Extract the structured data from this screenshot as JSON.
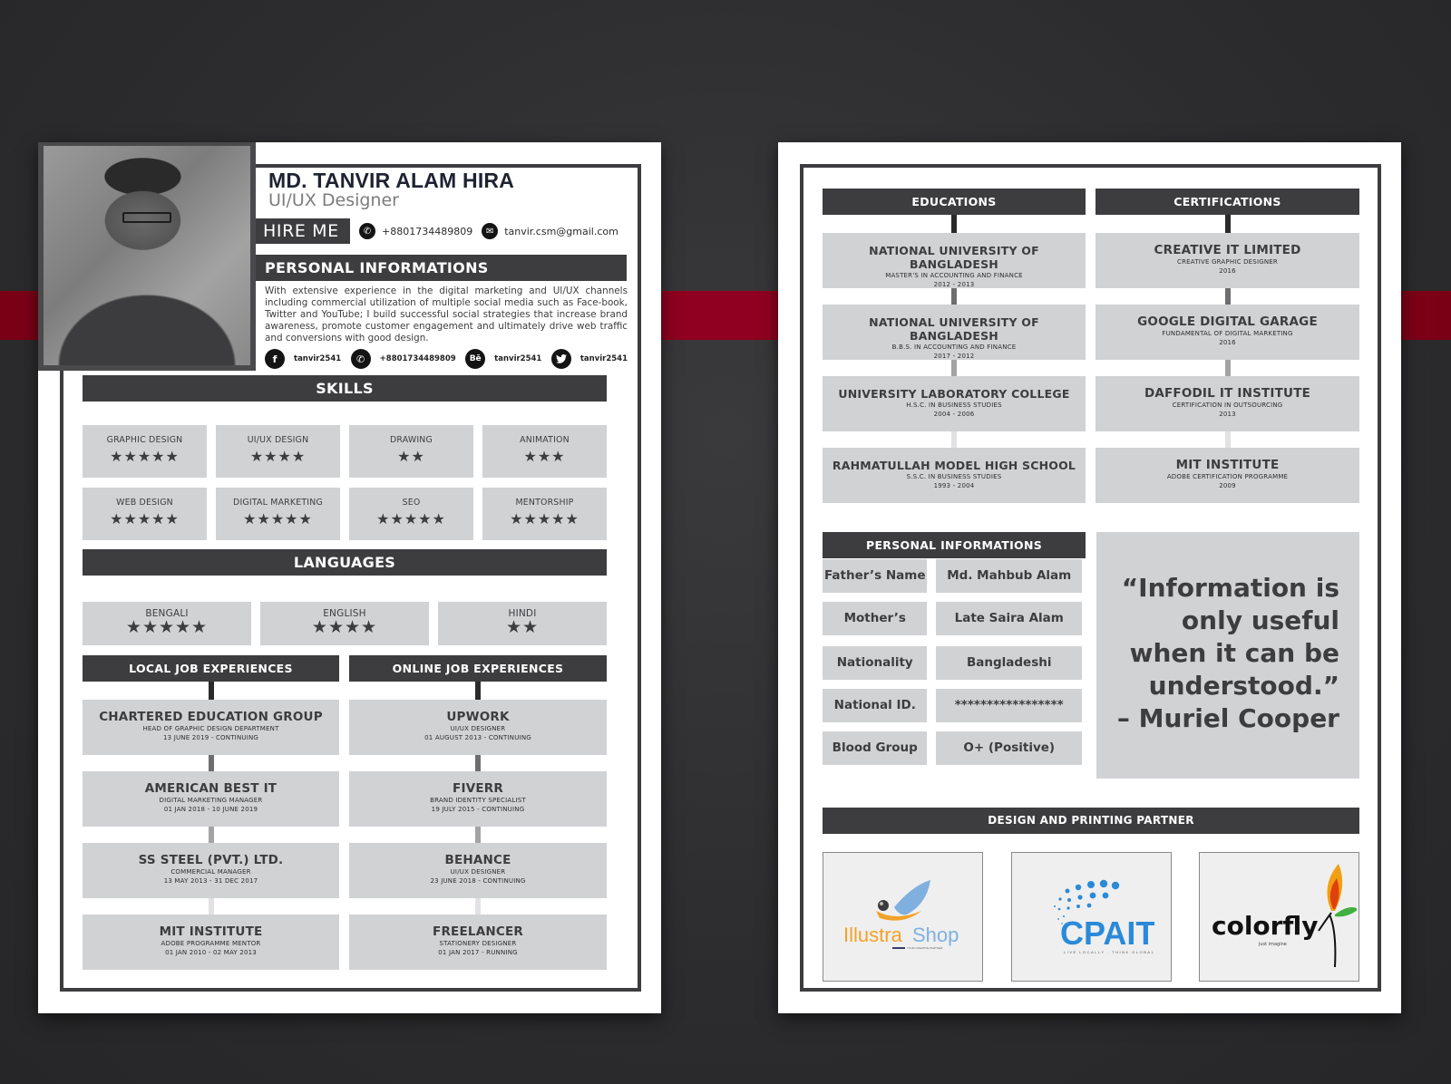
{
  "resume": {
    "name": "MD. TANVIR ALAM HIRA",
    "title": "UI/UX Designer",
    "hire_me": "HIRE ME",
    "phone": "+8801734489809",
    "email": "tanvir.csm@gmail.com",
    "personal_heading": "PERSONAL INFORMATIONS",
    "bio": "With extensive experience in the digital marketing and UI/UX channels including commercial utilization of multiple social media such as Face-book, Twitter and YouTube; I build successful social strategies that increase brand awareness, promote customer engagement and ultimately drive web traffic and conversions with good design.",
    "social": [
      {
        "icon": "facebook-icon",
        "glyph": "f",
        "handle": "tanvir2541"
      },
      {
        "icon": "whatsapp-icon",
        "glyph": "✆",
        "handle": "+8801734489809"
      },
      {
        "icon": "behance-icon",
        "glyph": "Bē",
        "handle": "tanvir2541"
      },
      {
        "icon": "twitter-icon",
        "glyph": "🐦",
        "handle": "tanvir2541"
      }
    ],
    "skills_heading": "SKILLS",
    "skills": [
      {
        "label": "GRAPHIC DESIGN",
        "rating": 5,
        "stars": "★★★★★"
      },
      {
        "label": "UI/UX DESIGN",
        "rating": 4,
        "stars": "★★★★"
      },
      {
        "label": "DRAWING",
        "rating": 2,
        "stars": "★★"
      },
      {
        "label": "ANIMATION",
        "rating": 3,
        "stars": "★★★"
      },
      {
        "label": "WEB DESIGN",
        "rating": 5,
        "stars": "★★★★★"
      },
      {
        "label": "DIGITAL MARKETING",
        "rating": 5,
        "stars": "★★★★★"
      },
      {
        "label": "SEO",
        "rating": 5,
        "stars": "★★★★★"
      },
      {
        "label": "MENTORSHIP",
        "rating": 5,
        "stars": "★★★★★"
      }
    ],
    "languages_heading": "LANGUAGES",
    "languages": [
      {
        "label": "BENGALI",
        "rating": 5,
        "stars": "★★★★★"
      },
      {
        "label": "ENGLISH",
        "rating": 4,
        "stars": "★★★★"
      },
      {
        "label": "HINDI",
        "rating": 2,
        "stars": "★★"
      }
    ],
    "local_jobs_heading": "LOCAL JOB EXPERIENCES",
    "local_jobs": [
      {
        "company": "CHARTERED EDUCATION GROUP",
        "role": "HEAD OF GRAPHIC DESIGN DEPARTMENT",
        "period": "13 JUNE 2019 - CONTINUING"
      },
      {
        "company": "AMERICAN BEST IT",
        "role": "DIGITAL MARKETING MANAGER",
        "period": "01 JAN 2018 - 10 JUNE 2019"
      },
      {
        "company": "SS STEEL (PVT.) LTD.",
        "role": "COMMERCIAL MANAGER",
        "period": "13 MAY 2013 - 31 DEC 2017"
      },
      {
        "company": "MIT INSTITUTE",
        "role": "ADOBE PROGRAMME MENTOR",
        "period": "01 JAN 2010 - 02 MAY 2013"
      }
    ],
    "online_jobs_heading": "ONLINE JOB EXPERIENCES",
    "online_jobs": [
      {
        "company": "UPWORK",
        "role": "UI/UX DESIGNER",
        "period": "01 AUGUST 2013 - CONTINUING"
      },
      {
        "company": "FIVERR",
        "role": "BRAND IDENTITY SPECIALIST",
        "period": "19 JULY 2015 - CONTINUING"
      },
      {
        "company": "BEHANCE",
        "role": "UI/UX DESIGNER",
        "period": "23 JUNE 2018 - CONTINUING"
      },
      {
        "company": "FREELANCER",
        "role": "STATIONERY DESIGNER",
        "period": "01 JAN 2017 - RUNNING"
      }
    ]
  },
  "page2": {
    "educations_heading": "EDUCATIONS",
    "educations": [
      {
        "school": "NATIONAL UNIVERSITY OF BANGLADESH",
        "degree": "MASTER'S IN ACCOUNTING AND FINANCE",
        "years": "2012 - 2013"
      },
      {
        "school": "NATIONAL UNIVERSITY OF BANGLADESH",
        "degree": "B.B.S. IN ACCOUNTING AND FINANCE",
        "years": "2017 - 2012"
      },
      {
        "school": "UNIVERSITY LABORATORY COLLEGE",
        "degree": "H.S.C. IN BUSINESS STUDIES",
        "years": "2004 - 2006"
      },
      {
        "school": "RAHMATULLAH MODEL HIGH SCHOOL",
        "degree": "S.S.C. IN BUSINESS STUDIES",
        "years": "1993 - 2004"
      }
    ],
    "certifications_heading": "CERTIFICATIONS",
    "certifications": [
      {
        "org": "CREATIVE IT LIMITED",
        "course": "CREATIVE GRAPHIC DESIGNER",
        "year": "2016"
      },
      {
        "org": "GOOGLE DIGITAL GARAGE",
        "course": "FUNDAMENTAL OF DIGITAL MARKETING",
        "year": "2016"
      },
      {
        "org": "DAFFODIL IT INSTITUTE",
        "course": "CERTIFICATION IN OUTSOURCING",
        "year": "2013"
      },
      {
        "org": "MIT INSTITUTE",
        "course": "ADOBE CERTIFICATION PROGRAMME",
        "year": "2009"
      }
    ],
    "personal_heading": "PERSONAL INFORMATIONS",
    "personal_info": [
      {
        "label": "Father’s Name",
        "value": "Md. Mahbub Alam"
      },
      {
        "label": "Mother’s Name",
        "value": "Late Saira Alam"
      },
      {
        "label": "Nationality",
        "value": "Bangladeshi"
      },
      {
        "label": "National ID.",
        "value": "*****************"
      },
      {
        "label": "Blood Group",
        "value": "O+ (Positive)"
      }
    ],
    "quote": "“Information is only useful when it can be understood.”",
    "quote_author": "– Muriel Cooper",
    "partners_heading": "DESIGN AND PRINTING PARTNER",
    "partners": [
      {
        "name": "IllustraShop",
        "part1": "Illustra",
        "part2": "Shop",
        "tagline": "YOUR CREATIVE PARTNER"
      },
      {
        "name": "CPAIT",
        "part1": "CPAIT",
        "tagline": "LIVE LOCALLY . THINK GLOBALLY"
      },
      {
        "name": "colorfly",
        "part1": "colorfly",
        "tagline": "just imagine"
      }
    ]
  },
  "colors": {
    "dark_bar": "#3d3d3f",
    "tile_gray": "#d1d2d4",
    "accent_red": "#900020",
    "background": "#2c2c2e"
  }
}
